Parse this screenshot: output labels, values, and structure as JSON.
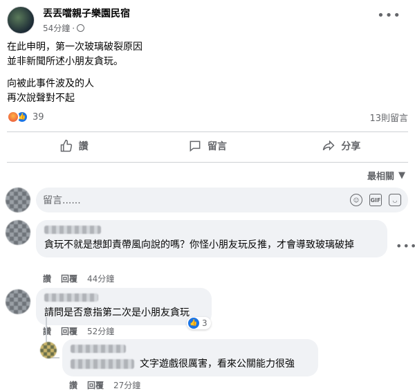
{
  "post": {
    "page_name": "丟丟噹親子樂園民宿",
    "time": "54分鐘",
    "body_lines_1": [
      "在此申明，第一次玻璃破裂原因",
      "並非新聞所述小朋友貪玩。"
    ],
    "body_lines_2": [
      "向被此事件波及的人",
      "再次說聲對不起"
    ],
    "reaction_count": "39",
    "comment_count": "13則留言",
    "more_icon": "more-horizontal-icon",
    "privacy_icon": "globe-icon"
  },
  "actions": {
    "like": "讚",
    "comment": "留言",
    "share": "分享"
  },
  "sort": {
    "label": "最相關"
  },
  "composer": {
    "placeholder": "留言......",
    "icons": [
      "emoji-icon",
      "gif-icon",
      "sticker-icon"
    ]
  },
  "comments": [
    {
      "text": "貪玩不就是想卸責帶風向說的嗎？你怪小朋友玩反推，才會導致玻璃破掉",
      "like": "讚",
      "reply": "回覆",
      "time": "44分鐘"
    },
    {
      "text": "請問是否意指第二次是小朋友貪玩",
      "like": "讚",
      "reply": "回覆",
      "time": "52分鐘",
      "reaction_count": "3"
    },
    {
      "text": "文字遊戲很厲害，看來公關能力很強",
      "like": "讚",
      "reply": "回覆",
      "time": "27分鐘"
    }
  ],
  "colors": {
    "accent": "#1b74e4",
    "muted": "#65676b",
    "bubble": "#f0f2f5"
  }
}
